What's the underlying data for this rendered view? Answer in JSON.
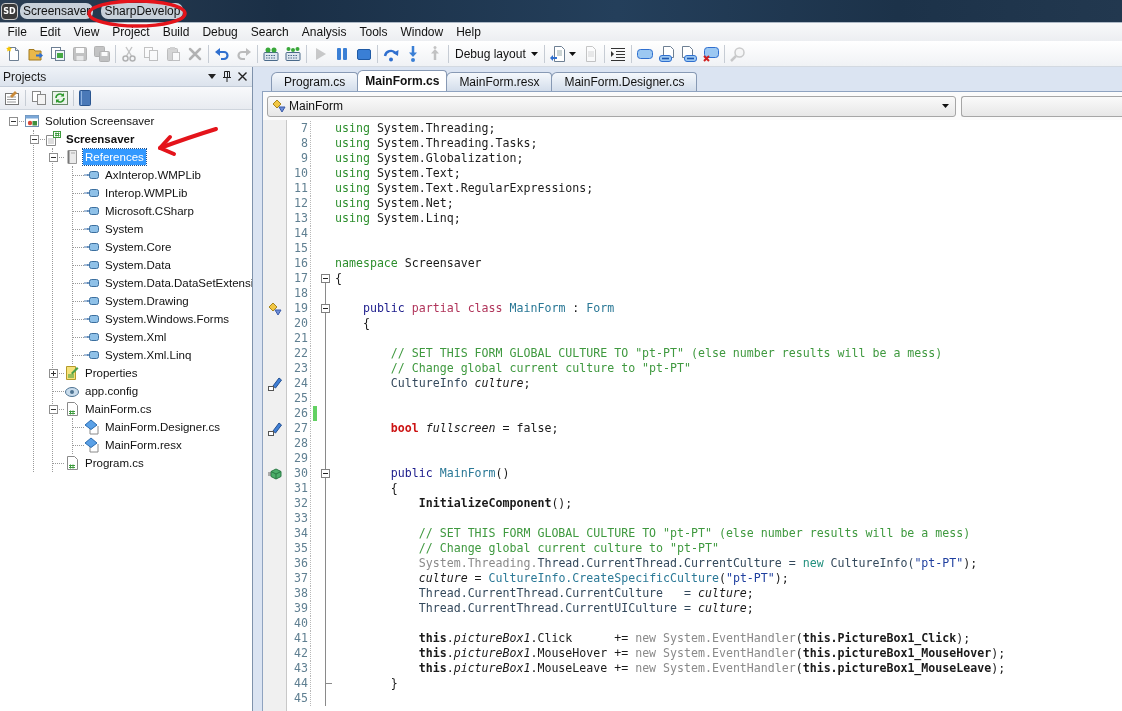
{
  "window": {
    "icon_label": "SD",
    "title": "Screensaver",
    "app_name": "SharpDevelop"
  },
  "menu": [
    "File",
    "Edit",
    "View",
    "Project",
    "Build",
    "Debug",
    "Search",
    "Analysis",
    "Tools",
    "Window",
    "Help"
  ],
  "toolbar": [
    {
      "kind": "new",
      "disabled": false
    },
    {
      "kind": "open",
      "disabled": false
    },
    {
      "kind": "open-solution",
      "disabled": false
    },
    {
      "kind": "save",
      "disabled": true
    },
    {
      "kind": "save-all",
      "disabled": true
    },
    {
      "kind": "separator"
    },
    {
      "kind": "cut",
      "disabled": true
    },
    {
      "kind": "copy",
      "disabled": true
    },
    {
      "kind": "paste",
      "disabled": true
    },
    {
      "kind": "delete",
      "disabled": true
    },
    {
      "kind": "separator"
    },
    {
      "kind": "undo",
      "disabled": false
    },
    {
      "kind": "redo",
      "disabled": true
    },
    {
      "kind": "separator"
    },
    {
      "kind": "build",
      "disabled": false
    },
    {
      "kind": "rebuild",
      "disabled": false
    },
    {
      "kind": "separator"
    },
    {
      "kind": "run",
      "disabled": true
    },
    {
      "kind": "pause",
      "disabled": false
    },
    {
      "kind": "stop",
      "disabled": false
    },
    {
      "kind": "separator"
    },
    {
      "kind": "step-over",
      "disabled": false
    },
    {
      "kind": "step-into",
      "disabled": false
    },
    {
      "kind": "step-out",
      "disabled": true
    },
    {
      "kind": "separator"
    },
    {
      "kind": "dropdown",
      "label": "Debug layout"
    },
    {
      "kind": "separator"
    },
    {
      "kind": "insert-document",
      "disabled": false
    },
    {
      "kind": "document",
      "disabled": true
    },
    {
      "kind": "separator"
    },
    {
      "kind": "indent",
      "disabled": false
    },
    {
      "kind": "separator"
    },
    {
      "kind": "bookmark",
      "disabled": false
    },
    {
      "kind": "previous-bookmark",
      "disabled": false
    },
    {
      "kind": "next-bookmark",
      "disabled": false
    },
    {
      "kind": "clear-bookmarks",
      "disabled": false
    },
    {
      "kind": "separator"
    },
    {
      "kind": "find",
      "disabled": true
    }
  ],
  "projects": {
    "title": "Projects",
    "tree": [
      {
        "label": "Solution Screensaver",
        "kind": "solution",
        "selected": false,
        "expanded": true,
        "children": [
          {
            "label": "Screensaver",
            "kind": "project",
            "selected": false,
            "expanded": true,
            "children": [
              {
                "label": "References",
                "kind": "references",
                "selected": true,
                "expanded": true,
                "children": [
                  {
                    "label": "AxInterop.WMPLib",
                    "kind": "assembly",
                    "selected": false
                  },
                  {
                    "label": "Interop.WMPLib",
                    "kind": "assembly",
                    "selected": false
                  },
                  {
                    "label": "Microsoft.CSharp",
                    "kind": "assembly",
                    "selected": false
                  },
                  {
                    "label": "System",
                    "kind": "assembly",
                    "selected": false
                  },
                  {
                    "label": "System.Core",
                    "kind": "assembly",
                    "selected": false
                  },
                  {
                    "label": "System.Data",
                    "kind": "assembly",
                    "selected": false
                  },
                  {
                    "label": "System.Data.DataSetExtensi",
                    "kind": "assembly",
                    "selected": false
                  },
                  {
                    "label": "System.Drawing",
                    "kind": "assembly",
                    "selected": false
                  },
                  {
                    "label": "System.Windows.Forms",
                    "kind": "assembly",
                    "selected": false
                  },
                  {
                    "label": "System.Xml",
                    "kind": "assembly",
                    "selected": false
                  },
                  {
                    "label": "System.Xml.Linq",
                    "kind": "assembly",
                    "selected": false
                  }
                ]
              },
              {
                "label": "Properties",
                "kind": "properties",
                "selected": false,
                "expanded": false
              },
              {
                "label": "app.config",
                "kind": "config",
                "selected": false
              },
              {
                "label": "MainForm.cs",
                "kind": "code",
                "selected": false,
                "expanded": true,
                "children": [
                  {
                    "label": "MainForm.Designer.cs",
                    "kind": "form-part",
                    "selected": false
                  },
                  {
                    "label": "MainForm.resx",
                    "kind": "form-part",
                    "selected": false
                  }
                ]
              },
              {
                "label": "Program.cs",
                "kind": "code",
                "selected": false
              }
            ]
          }
        ]
      }
    ]
  },
  "tabs": [
    {
      "label": "Program.cs",
      "selected": false
    },
    {
      "label": "MainForm.cs",
      "selected": true
    },
    {
      "label": "MainForm.resx",
      "selected": false
    },
    {
      "label": "MainForm.Designer.cs",
      "selected": false
    }
  ],
  "editor": {
    "class_selector": "MainForm",
    "lines": [
      {
        "number": "7",
        "changed": false,
        "tokens": [
          {
            "text": "using",
            "kind": "keyword"
          },
          {
            "text": " System.Threading;",
            "kind": "plain"
          }
        ]
      },
      {
        "number": "8",
        "changed": false,
        "tokens": [
          {
            "text": "using",
            "kind": "keyword"
          },
          {
            "text": " System.Threading.Tasks;",
            "kind": "plain"
          }
        ]
      },
      {
        "number": "9",
        "changed": false,
        "tokens": [
          {
            "text": "using",
            "kind": "keyword"
          },
          {
            "text": " System.Globalization;",
            "kind": "plain"
          }
        ]
      },
      {
        "number": "10",
        "changed": false,
        "tokens": [
          {
            "text": "using",
            "kind": "keyword"
          },
          {
            "text": " System.Text;",
            "kind": "plain"
          }
        ]
      },
      {
        "number": "11",
        "changed": false,
        "tokens": [
          {
            "text": "using",
            "kind": "keyword"
          },
          {
            "text": " System.Text.RegularExpressions;",
            "kind": "plain"
          }
        ]
      },
      {
        "number": "12",
        "changed": false,
        "tokens": [
          {
            "text": "using",
            "kind": "keyword"
          },
          {
            "text": " System.Net;",
            "kind": "plain"
          }
        ]
      },
      {
        "number": "13",
        "changed": false,
        "tokens": [
          {
            "text": "using",
            "kind": "keyword"
          },
          {
            "text": " System.Linq;",
            "kind": "plain"
          }
        ]
      },
      {
        "number": "14",
        "changed": false
      },
      {
        "number": "15",
        "changed": false
      },
      {
        "number": "16",
        "changed": false,
        "tokens": [
          {
            "text": "namespace",
            "kind": "keyword"
          },
          {
            "text": " Screensaver",
            "kind": "plain"
          }
        ]
      },
      {
        "number": "17",
        "changed": false,
        "fold": {
          "kind": "start",
          "expanded": true
        },
        "tokens": [
          {
            "text": "{",
            "kind": "plain"
          }
        ]
      },
      {
        "number": "18",
        "changed": false
      },
      {
        "number": "19",
        "changed": false,
        "fold": {
          "kind": "start",
          "expanded": true
        },
        "member": {
          "kind": "class"
        },
        "tokens": [
          {
            "text": "    public",
            "kind": "modifier"
          },
          {
            "text": " partial class",
            "kind": "declaration"
          },
          {
            "text": " MainForm",
            "kind": "type"
          },
          {
            "text": " : ",
            "kind": "plain"
          },
          {
            "text": "Form",
            "kind": "type"
          }
        ]
      },
      {
        "number": "20",
        "changed": false,
        "tokens": [
          {
            "text": "    {",
            "kind": "plain"
          }
        ]
      },
      {
        "number": "21",
        "changed": false
      },
      {
        "number": "22",
        "changed": false,
        "tokens": [
          {
            "text": "        // SET THIS FORM GLOBAL CULTURE TO \"pt-PT\" (else number results will be a mess)",
            "kind": "comment"
          }
        ]
      },
      {
        "number": "23",
        "changed": false,
        "tokens": [
          {
            "text": "        // Change global current culture to \"pt-PT\"",
            "kind": "comment"
          }
        ]
      },
      {
        "number": "24",
        "changed": false,
        "member": {
          "kind": "field"
        },
        "tokens": [
          {
            "text": "        CultureInfo",
            "kind": "member"
          },
          {
            "text": " culture",
            "kind": "field"
          },
          {
            "text": ";",
            "kind": "plain"
          }
        ]
      },
      {
        "number": "25",
        "changed": false
      },
      {
        "number": "26",
        "changed": true
      },
      {
        "number": "27",
        "changed": false,
        "member": {
          "kind": "field"
        },
        "tokens": [
          {
            "text": "        bool",
            "kind": "valuetype"
          },
          {
            "text": " fullscreen",
            "kind": "field"
          },
          {
            "text": " = false;",
            "kind": "plain"
          }
        ]
      },
      {
        "number": "28",
        "changed": false
      },
      {
        "number": "29",
        "changed": false
      },
      {
        "number": "30",
        "changed": false,
        "fold": {
          "kind": "start",
          "expanded": true
        },
        "member": {
          "kind": "method"
        },
        "tokens": [
          {
            "text": "        public",
            "kind": "modifier"
          },
          {
            "text": " MainForm",
            "kind": "type"
          },
          {
            "text": "()",
            "kind": "plain"
          }
        ]
      },
      {
        "number": "31",
        "changed": false,
        "tokens": [
          {
            "text": "        {",
            "kind": "plain"
          }
        ]
      },
      {
        "number": "32",
        "changed": false,
        "tokens": [
          {
            "text": "            InitializeComponent",
            "kind": "strong"
          },
          {
            "text": "();",
            "kind": "plain"
          }
        ]
      },
      {
        "number": "33",
        "changed": false
      },
      {
        "number": "34",
        "changed": false,
        "tokens": [
          {
            "text": "            // SET THIS FORM GLOBAL CULTURE TO \"pt-PT\" (else number results will be a mess)",
            "kind": "comment"
          }
        ]
      },
      {
        "number": "35",
        "changed": false,
        "tokens": [
          {
            "text": "            // Change global current culture to \"pt-PT\"",
            "kind": "comment"
          }
        ]
      },
      {
        "number": "36",
        "changed": false,
        "tokens": [
          {
            "text": "            System.Threading.",
            "kind": "dim"
          },
          {
            "text": "Thread.CurrentThread.CurrentCulture = ",
            "kind": "member"
          },
          {
            "text": "new",
            "kind": "new"
          },
          {
            "text": " CultureInfo(",
            "kind": "member"
          },
          {
            "text": "\"pt-PT\"",
            "kind": "string"
          },
          {
            "text": ");",
            "kind": "plain"
          }
        ]
      },
      {
        "number": "37",
        "changed": false,
        "tokens": [
          {
            "text": "            culture",
            "kind": "field"
          },
          {
            "text": " = ",
            "kind": "plain"
          },
          {
            "text": "CultureInfo.CreateSpecificCulture",
            "kind": "type"
          },
          {
            "text": "(",
            "kind": "plain"
          },
          {
            "text": "\"pt-PT\"",
            "kind": "string"
          },
          {
            "text": ");",
            "kind": "plain"
          }
        ]
      },
      {
        "number": "38",
        "changed": false,
        "tokens": [
          {
            "text": "            Thread.CurrentThread.CurrentCulture   = ",
            "kind": "member"
          },
          {
            "text": "culture",
            "kind": "field"
          },
          {
            "text": ";",
            "kind": "plain"
          }
        ]
      },
      {
        "number": "39",
        "changed": false,
        "tokens": [
          {
            "text": "            Thread.CurrentThread.CurrentUICulture = ",
            "kind": "member"
          },
          {
            "text": "culture",
            "kind": "field"
          },
          {
            "text": ";",
            "kind": "plain"
          }
        ]
      },
      {
        "number": "40",
        "changed": false
      },
      {
        "number": "41",
        "changed": false,
        "tokens": [
          {
            "text": "            this",
            "kind": "strong"
          },
          {
            "text": ".",
            "kind": "plain"
          },
          {
            "text": "pictureBox1",
            "kind": "field"
          },
          {
            "text": ".Click      += ",
            "kind": "plain"
          },
          {
            "text": "new System.EventHandler",
            "kind": "dim"
          },
          {
            "text": "(",
            "kind": "plain"
          },
          {
            "text": "this.PictureBox1_Click",
            "kind": "strong"
          },
          {
            "text": ");",
            "kind": "plain"
          }
        ]
      },
      {
        "number": "42",
        "changed": false,
        "tokens": [
          {
            "text": "            this",
            "kind": "strong"
          },
          {
            "text": ".",
            "kind": "plain"
          },
          {
            "text": "pictureBox1",
            "kind": "field"
          },
          {
            "text": ".MouseHover += ",
            "kind": "plain"
          },
          {
            "text": "new System.EventHandler",
            "kind": "dim"
          },
          {
            "text": "(",
            "kind": "plain"
          },
          {
            "text": "this.pictureBox1_MouseHover",
            "kind": "strong"
          },
          {
            "text": ");",
            "kind": "plain"
          }
        ]
      },
      {
        "number": "43",
        "changed": false,
        "tokens": [
          {
            "text": "            this",
            "kind": "strong"
          },
          {
            "text": ".",
            "kind": "plain"
          },
          {
            "text": "pictureBox1",
            "kind": "field"
          },
          {
            "text": ".MouseLeave += ",
            "kind": "plain"
          },
          {
            "text": "new System.EventHandler",
            "kind": "dim"
          },
          {
            "text": "(",
            "kind": "plain"
          },
          {
            "text": "this.pictureBox1_MouseLeave",
            "kind": "strong"
          },
          {
            "text": ");",
            "kind": "plain"
          }
        ]
      },
      {
        "number": "44",
        "changed": false,
        "fold": {
          "kind": "end"
        },
        "tokens": [
          {
            "text": "        }",
            "kind": "plain"
          }
        ]
      },
      {
        "number": "45",
        "changed": false
      }
    ]
  }
}
